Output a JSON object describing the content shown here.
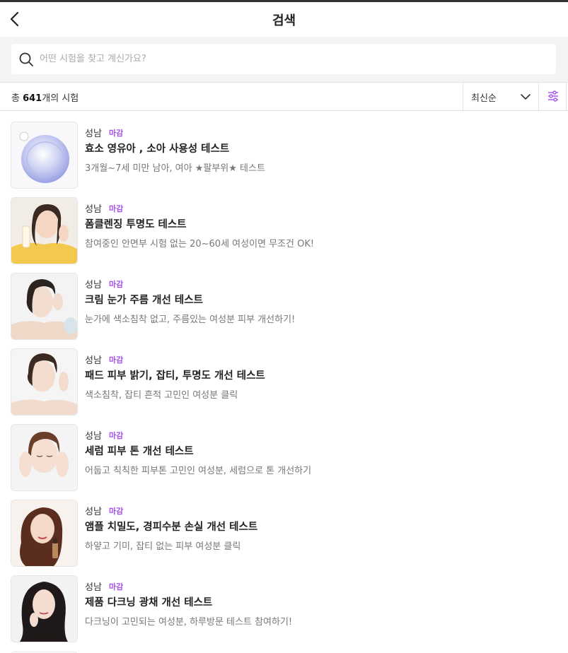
{
  "header": {
    "title": "검색"
  },
  "search": {
    "placeholder": "어떤 시험을 찾고 계신가요?",
    "value": ""
  },
  "filter_bar": {
    "total_prefix": "총 ",
    "total_count": "641",
    "total_suffix": "개의 시험",
    "sort_label": "최신순"
  },
  "colors": {
    "accent": "#a64ff0",
    "background_search": "#f4f4f6"
  },
  "icons": {
    "back": "chevron-left-icon",
    "search": "search-icon",
    "sort": "chevron-down-icon",
    "filter": "sliders-icon"
  },
  "tests": [
    {
      "location": "성남",
      "status": "마감",
      "title": "효소 영유아 , 소아 사용성 테스트",
      "description": "3개월~7세 미만 남아, 여아 ★팔부위★ 테스트",
      "thumbnail": "cream-jar"
    },
    {
      "location": "성남",
      "status": "마감",
      "title": "폼클렌징 투명도 테스트",
      "description": "참여중인 안면부 시험 없는 20~60세 여성이면 무조건 OK!",
      "thumbnail": "woman-yellow"
    },
    {
      "location": "성남",
      "status": "마감",
      "title": "크림 눈가 주름 개선 테스트",
      "description": "눈가에 색소침착 없고, 주름있는 여성분 피부 개선하기!",
      "thumbnail": "woman-cream"
    },
    {
      "location": "성남",
      "status": "마감",
      "title": "패드 피부 밝기, 잡티, 투명도 개선 테스트",
      "description": "색소침착, 잡티 흔적 고민인 여성분 클릭",
      "thumbnail": "woman-hand"
    },
    {
      "location": "성남",
      "status": "마감",
      "title": "세럼 피부 톤 개선 테스트",
      "description": "어둡고 칙칙한 피부톤 고민인 여성분, 세럼으로 톤 개선하기",
      "thumbnail": "woman-closed-eyes"
    },
    {
      "location": "성남",
      "status": "마감",
      "title": "앰플 치밀도, 경피수분 손실 개선 테스트",
      "description": "하얗고 기미, 잡티 없는 피부 여성분 클릭",
      "thumbnail": "woman-ampoule"
    },
    {
      "location": "성남",
      "status": "마감",
      "title": "제품 다크닝 광채 개선 테스트",
      "description": "다크닝이 고민되는 여성분, 하루방문 테스트 참여하기!",
      "thumbnail": "woman-dark-hair"
    }
  ]
}
